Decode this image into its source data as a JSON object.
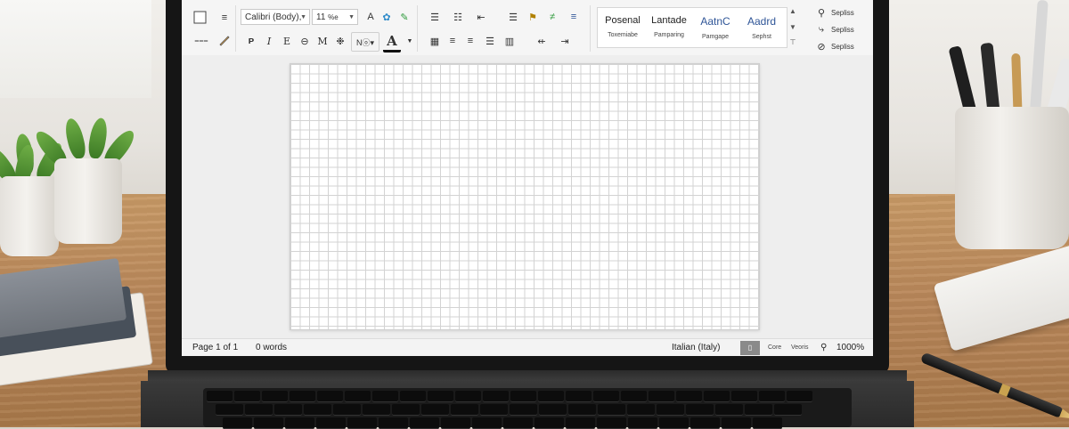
{
  "ribbon": {
    "font_name": "Calibri (Body),",
    "font_size": "11",
    "font_size_extra": "%e",
    "styles": [
      {
        "preview": "Posenal",
        "caption": "Toxemiabe"
      },
      {
        "preview": "Lantade",
        "caption": "Pamparing"
      },
      {
        "preview": "AatnC",
        "caption": "Pamgape"
      },
      {
        "preview": "Aadrd",
        "caption": "Sephst"
      }
    ],
    "editing": [
      "Sepliss",
      "Sepliss",
      "Sepliss"
    ]
  },
  "status": {
    "page": "Page 1 of 1",
    "words": "0 words",
    "language": "Italian (Italy)",
    "view1": "Core",
    "view2": "Veoris",
    "zoom": "1000%"
  }
}
